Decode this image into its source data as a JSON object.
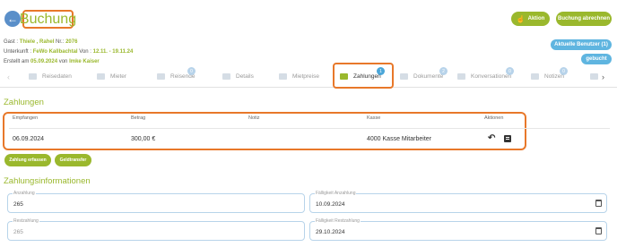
{
  "header": {
    "back_icon": "arrow-left-icon",
    "title": "Buchung",
    "btn_aktion": "Aktion",
    "btn_abrechnen": "Buchung abrechnen",
    "btn_user": "Aktuelle Benutzer (1)",
    "btn_gebucht": "gebucht"
  },
  "info": {
    "gast_label": "Gast :",
    "gast_value": "Thiele , Rahel",
    "nr_label": "Nr.:",
    "nr_value": "2076",
    "unterkunft_label": "Unterkunft :",
    "unterkunft_value": "FeWo Kallbachtal",
    "von_label": "Von :",
    "von_value": "12.11. - 19.11.24",
    "erstellt_label": "Erstellt am",
    "erstellt_value": "05.09.2024",
    "von2_label": "von",
    "von2_value": "Imke Kaiser"
  },
  "tabs": [
    {
      "label": "Reisedaten",
      "badge": ""
    },
    {
      "label": "Mieter",
      "badge": ""
    },
    {
      "label": "Reisende",
      "badge": "0"
    },
    {
      "label": "Details",
      "badge": ""
    },
    {
      "label": "Mietpreise",
      "badge": ""
    },
    {
      "label": "Zahlungen",
      "badge": "1"
    },
    {
      "label": "Dokumente",
      "badge": "2"
    },
    {
      "label": "Konversationen",
      "badge": "0"
    },
    {
      "label": "Notizen",
      "badge": "0"
    }
  ],
  "zahlungen": {
    "title": "Zahlungen",
    "columns": [
      "Empfangen",
      "Betrag",
      "Notiz",
      "Kasse",
      "Aktionen"
    ],
    "rows": [
      {
        "empfangen": "06.09.2024",
        "betrag": "300,00 €",
        "notiz": "",
        "kasse": "4000 Kasse Mitarbeiter"
      }
    ],
    "btn_erfassen": "Zahlung erfassen",
    "btn_geldtransfer": "Geldtransfer"
  },
  "zahlungsinfo": {
    "title": "Zahlungsinformationen",
    "anzahlung_label": "Anzahlung",
    "anzahlung_value": "265",
    "faelligkeit_anzahlung_label": "Fälligkeit Anzahlung",
    "faelligkeit_anzahlung_value": "10.09.2024",
    "restzahlung_label": "Restzahlung",
    "restzahlung_value": "265",
    "faelligkeit_rest_label": "Fälligkeit Restzahlung",
    "faelligkeit_rest_value": "29.10.2024"
  }
}
